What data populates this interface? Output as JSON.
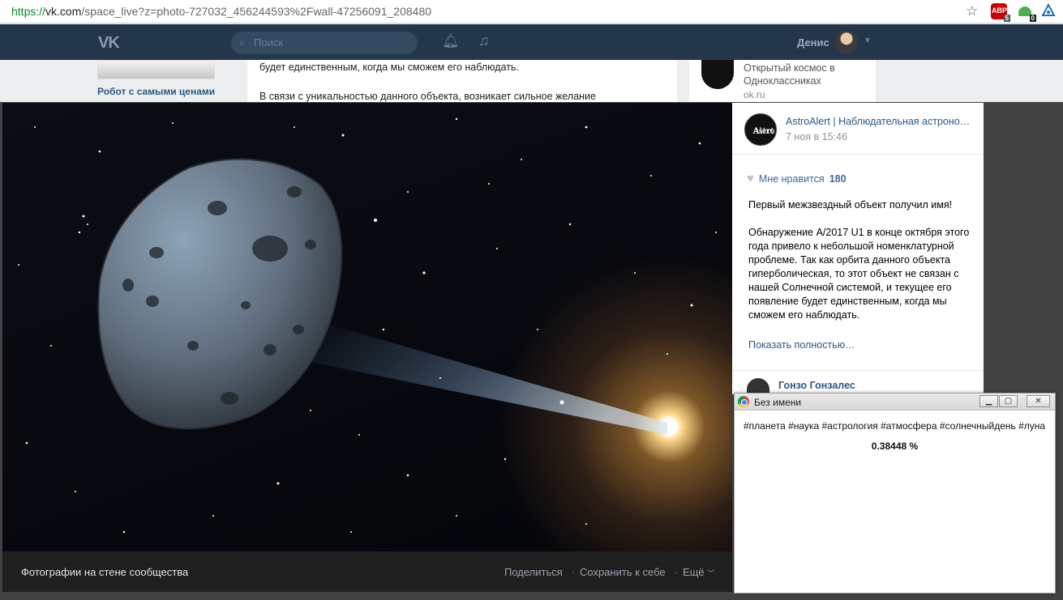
{
  "browser": {
    "url_scheme": "https://",
    "url_host": "vk.com",
    "url_path": "/space_live?z=photo-727032_456244593%2Fwall-47256091_208480",
    "abp_label": "ABP",
    "abp_badge": "5",
    "ext_badge": "0"
  },
  "vk": {
    "logo": "VK",
    "search_placeholder": "Поиск",
    "user_name": "Денис"
  },
  "background": {
    "left_link": "Робот с самыми ценами",
    "center_line1": "будет единственным, когда мы сможем его наблюдать.",
    "center_line2": "В связи с уникальностью данного объекта, возникает сильное желание",
    "right_title": "Открытый космос в Одноклассниках",
    "right_url": "ok.ru"
  },
  "viewer": {
    "caption": "Фотографии на стене сообщества",
    "share": "Поделиться",
    "save": "Сохранить к себе",
    "more": "Ещё",
    "sep": "·"
  },
  "post": {
    "avatar_text_1": "Astro",
    "avatar_text_2": "Alert",
    "group_name": "AstroAlert | Наблюдательная астрономия",
    "date": "7 ноя в 15:46",
    "like_label": "Мне нравится",
    "like_count": "180",
    "paragraph1": "Первый межзвездный объект получил имя!",
    "paragraph2": "Обнаружение A/2017 U1 в конце октября этого года привело к небольшой номенклатурной проблеме. Так как орбита данного объекта гиперболическая, то этот объект не связан с нашей Солнечной системой, и текущее его появление будет единственным, когда мы сможем его наблюдать.",
    "show_more": "Показать полностью…",
    "commenter": "Гонзо Гонзалес"
  },
  "popup": {
    "title": "Без имени",
    "tags": "#планета #наука #астрология #атмосфера #солнечныйдень #луна",
    "percent": "0.38448 %"
  },
  "colors": {
    "vk_header": "#24364a",
    "link": "#2a5885",
    "viewer_bar": "#1f1f1f"
  }
}
